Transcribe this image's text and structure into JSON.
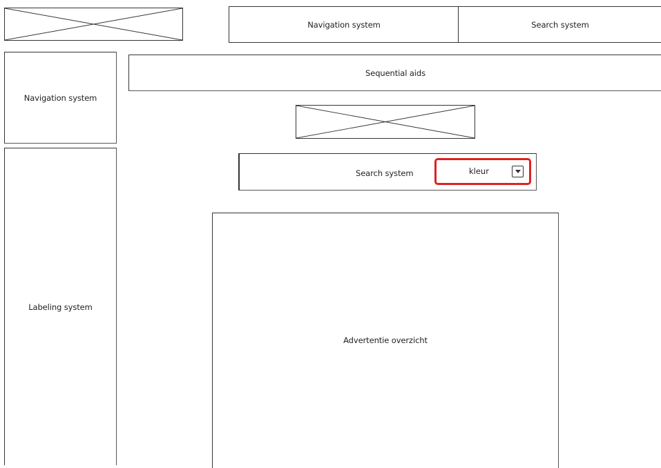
{
  "header": {
    "navigation_label": "Navigation system",
    "search_label": "Search system"
  },
  "sidebar": {
    "navigation_label": "Navigation system",
    "labeling_label": "Labeling system"
  },
  "main": {
    "sequential_aids_label": "Sequential aids",
    "search_bar_label": "Search system",
    "dropdown_value": "kleur",
    "ad_overview_label": "Advertentie overzicht"
  },
  "colors": {
    "highlight": "#e02020",
    "stroke": "#333333",
    "background": "#ffffff"
  },
  "icons": {
    "placeholder": "image-placeholder-icon",
    "dropdown_arrow": "chevron-down-icon"
  }
}
